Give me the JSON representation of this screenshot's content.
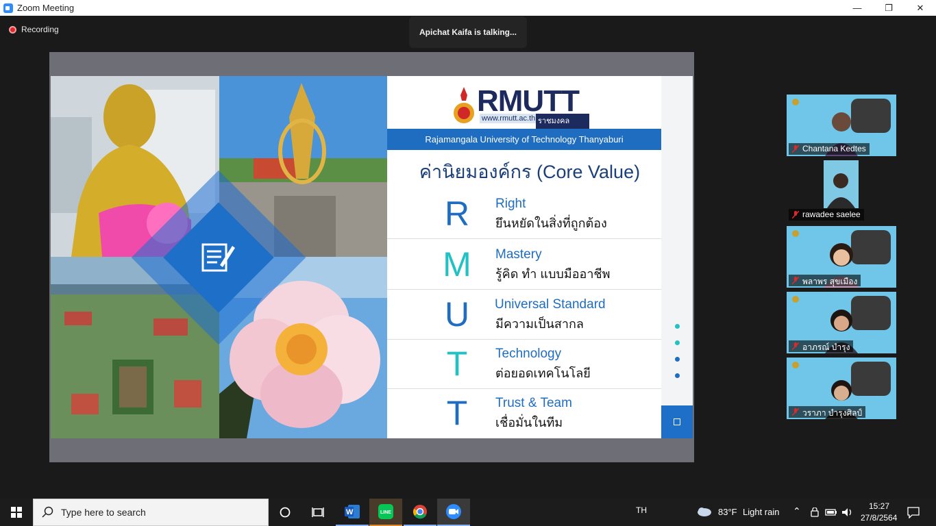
{
  "window": {
    "title": "Zoom Meeting",
    "minimize": "—",
    "restore": "❐",
    "close": "✕"
  },
  "meeting": {
    "recording_label": "Recording",
    "talking_label": "Apichat Kaifa is talking..."
  },
  "slide": {
    "logo": {
      "text": "RMUTT",
      "url": "www.rmutt.ac.th",
      "thai": "ราชมงคลธัญบุรี"
    },
    "university": "Rajamangala University of Technology Thanyaburi",
    "title": "ค่านิยมองค์กร (Core Value)",
    "values": [
      {
        "letter": "R",
        "en": "Right",
        "th": "ยึนหยัดในสิ่งที่ถูกต้อง",
        "color": "#1f6dc0"
      },
      {
        "letter": "M",
        "en": "Mastery",
        "th": "รู้คิด ทำ แบบมืออาชีพ",
        "color": "#22c1c3"
      },
      {
        "letter": "U",
        "en": "Universal Standard",
        "th": "มีความเป็นสากล",
        "color": "#1f6dc0"
      },
      {
        "letter": "T",
        "en": "Technology",
        "th": "ต่อยอดเทคโนโลยี",
        "color": "#22c1c3"
      },
      {
        "letter": "T",
        "en": "Trust & Team",
        "th": "เชื่อมั่นในทีม",
        "color": "#1f6dc0"
      }
    ],
    "dots": [
      "#22c1c3",
      "#22c1c3",
      "#1f6dc0",
      "#1f6dc0"
    ]
  },
  "participants": [
    {
      "name": "Chantana Kedtes"
    },
    {
      "name": "rawadee saelee"
    },
    {
      "name": "พลาพร สุขเมือง"
    },
    {
      "name": "อาภรณ์  บำรุง"
    },
    {
      "name": "วราภา บำรุงศิลป์"
    }
  ],
  "taskbar": {
    "search_placeholder": "Type here to search",
    "language": "TH",
    "weather": {
      "temp": "83°F",
      "desc": "Light rain"
    },
    "time": "15:27",
    "date": "27/8/2564"
  }
}
